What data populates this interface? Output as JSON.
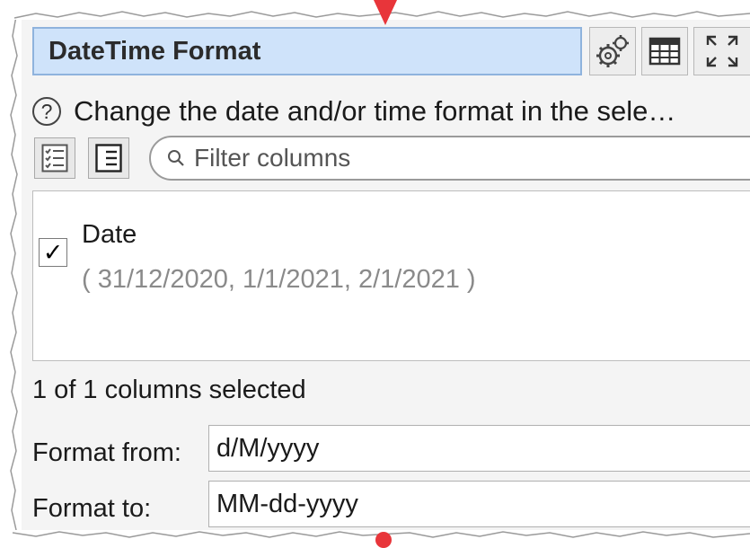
{
  "panel": {
    "title": "DateTime Format",
    "description": "Change the date and/or time format in the sele…",
    "toolbar": {
      "settings_icon": "gears-icon",
      "table_icon": "table-icon",
      "expand_icon": "expand-icon"
    }
  },
  "filter": {
    "placeholder": "Filter columns"
  },
  "columns": [
    {
      "name": "Date",
      "sample": "( 31/12/2020, 1/1/2021, 2/1/2021 )",
      "checked": true
    }
  ],
  "status": "1 of 1 columns selected",
  "form": {
    "from_label": "Format from:",
    "from_value": "d/M/yyyy",
    "to_label": "Format to:",
    "to_value": "MM-dd-yyyy"
  },
  "colors": {
    "title_bg": "#cfe3fa",
    "connector": "#e8353a"
  }
}
